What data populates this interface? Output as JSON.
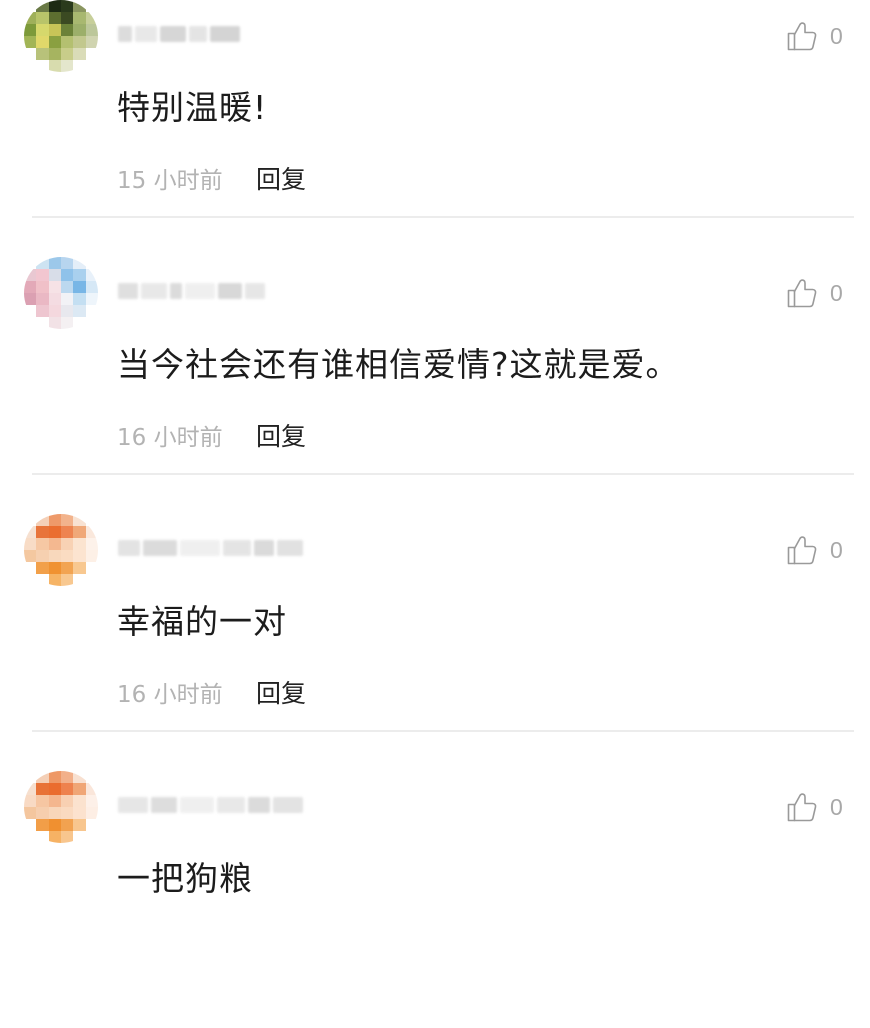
{
  "like_icon": "thumbs-up-outline-icon",
  "reply_label": "回复",
  "colors": {
    "text_primary": "#1c1c1c",
    "text_muted": "#b3b3b3",
    "like_gray": "#a8a8a8",
    "divider": "#ececec"
  },
  "comments": [
    {
      "avatar": {
        "pixels": [
          "#ffffff",
          "#6a7a46",
          "#1d2b14",
          "#2a3a1c",
          "#8a9660",
          "#ffffff",
          "#9fb05a",
          "#b8c46a",
          "#5d6e30",
          "#3b4a22",
          "#a8b870",
          "#c7cf9a",
          "#7d9a3a",
          "#d6d86c",
          "#c8c458",
          "#6b8238",
          "#9caf6a",
          "#bcc79a",
          "#a2b556",
          "#e0d86a",
          "#8aa040",
          "#b4c070",
          "#c2c88e",
          "#d0d4b0",
          "#ffffff",
          "#b8c27a",
          "#a6b460",
          "#c8cd8a",
          "#dadcb8",
          "#ffffff",
          "#ffffff",
          "#ffffff",
          "#d8dcae",
          "#e4e6cc",
          "#ffffff",
          "#ffffff"
        ]
      },
      "username_blocks": [
        "#d9d9d9",
        "#e6e6e6",
        "#d2d2d2",
        "#e2e2e2",
        "#d0d0d0"
      ],
      "likes": "0",
      "text": "特别温暖!",
      "time": "15 小时前"
    },
    {
      "avatar": {
        "pixels": [
          "#ffffff",
          "#cde3f2",
          "#9cc8ea",
          "#b7d5ef",
          "#e4eef8",
          "#ffffff",
          "#e9c8d2",
          "#f2c6d0",
          "#d8dde8",
          "#8fc2ea",
          "#a9d0ee",
          "#e8f1fa",
          "#e3a9b8",
          "#f0c0c8",
          "#f6e2e6",
          "#bcd8ef",
          "#78b6e6",
          "#d6e8f6",
          "#dba0b2",
          "#eab8c4",
          "#f4dce2",
          "#f2f2f6",
          "#c4dff2",
          "#eef5fb",
          "#ffffff",
          "#eec6d0",
          "#f4d8de",
          "#e8e8ee",
          "#dce9f4",
          "#ffffff",
          "#ffffff",
          "#ffffff",
          "#f2e2e6",
          "#f4f0f2",
          "#ffffff",
          "#ffffff"
        ]
      },
      "username_blocks": [
        "#dcdcdc",
        "#e6e6e6",
        "#d8d8d8",
        "#eeeeee",
        "#d4d4d4",
        "#e4e4e4"
      ],
      "likes": "0",
      "text": "当今社会还有谁相信爱情?这就是爱。",
      "time": "16 小时前"
    },
    {
      "avatar": {
        "pixels": [
          "#ffffff",
          "#f4d0b8",
          "#ee9a6a",
          "#f2b38c",
          "#f8e2d2",
          "#ffffff",
          "#f6e0d0",
          "#e8743a",
          "#ea6e30",
          "#ee8450",
          "#f0a878",
          "#fae8dc",
          "#f8dcc6",
          "#f6c8a4",
          "#f4b890",
          "#f8d2b4",
          "#fbe4d0",
          "#fdf2ea",
          "#f4c8a0",
          "#f6d0b0",
          "#f8d8bc",
          "#fadcc2",
          "#fce4d0",
          "#fdf0e6",
          "#ffffff",
          "#f2a04a",
          "#f09232",
          "#f2a452",
          "#f8c890",
          "#ffffff",
          "#ffffff",
          "#ffffff",
          "#f6b466",
          "#f8c890",
          "#ffffff",
          "#ffffff"
        ]
      },
      "username_blocks": [
        "#e0e0e0",
        "#d8d8d8",
        "#eeeeee",
        "#e2e2e2",
        "#d6d6d6",
        "#dedede"
      ],
      "likes": "0",
      "text": "幸福的一对",
      "time": "16 小时前"
    },
    {
      "avatar": {
        "pixels": [
          "#ffffff",
          "#f4cfb6",
          "#ee9866",
          "#f2b08a",
          "#f8e0d0",
          "#ffffff",
          "#f6dfce",
          "#e87236",
          "#ea6c2e",
          "#ee824e",
          "#f0a676",
          "#fae6da",
          "#f8dac4",
          "#f6c6a2",
          "#f4b68e",
          "#f8d0b2",
          "#fbe2ce",
          "#fdf0e8",
          "#f4c69e",
          "#f6ceae",
          "#f8d6ba",
          "#fadac0",
          "#fce2ce",
          "#fdeee4",
          "#ffffff",
          "#f29e48",
          "#f09030",
          "#f2a250",
          "#f8c68e",
          "#ffffff",
          "#ffffff",
          "#ffffff",
          "#f6b264",
          "#f8c68e",
          "#ffffff",
          "#ffffff"
        ]
      },
      "username_blocks": [
        "#e4e4e4",
        "#dadada",
        "#eeeeee",
        "#e6e6e6",
        "#d8d8d8",
        "#e0e0e0"
      ],
      "likes": "0",
      "text": "一把狗粮",
      "time": ""
    }
  ]
}
